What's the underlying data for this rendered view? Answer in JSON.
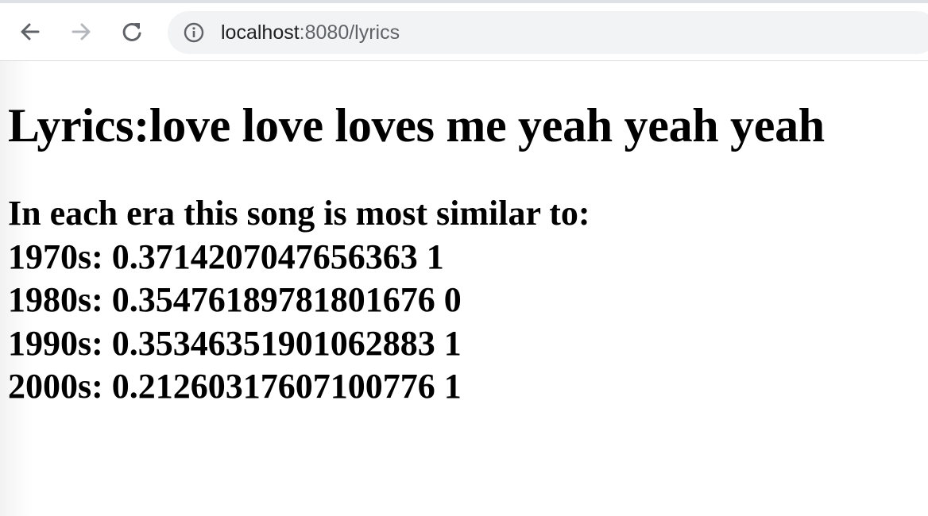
{
  "browser": {
    "url_host": "localhost",
    "url_rest": ":8080/lyrics"
  },
  "page": {
    "title": "Lyrics:love love loves me yeah yeah yeah",
    "intro": "In each era this song is most similar to:",
    "eras": [
      {
        "line": "1970s: 0.3714207047656363 1"
      },
      {
        "line": "1980s: 0.35476189781801676 0"
      },
      {
        "line": "1990s: 0.35346351901062883 1"
      },
      {
        "line": "2000s: 0.21260317607100776 1"
      }
    ]
  },
  "icons": {
    "back": "arrow-left-icon",
    "forward": "arrow-right-icon",
    "reload": "reload-icon",
    "info": "info-icon"
  },
  "colors": {
    "toolbar_bg": "#ffffff",
    "omnibox_bg": "#f1f3f4",
    "text": "#000000",
    "url_host": "#202124",
    "url_rest": "#5f6368"
  }
}
